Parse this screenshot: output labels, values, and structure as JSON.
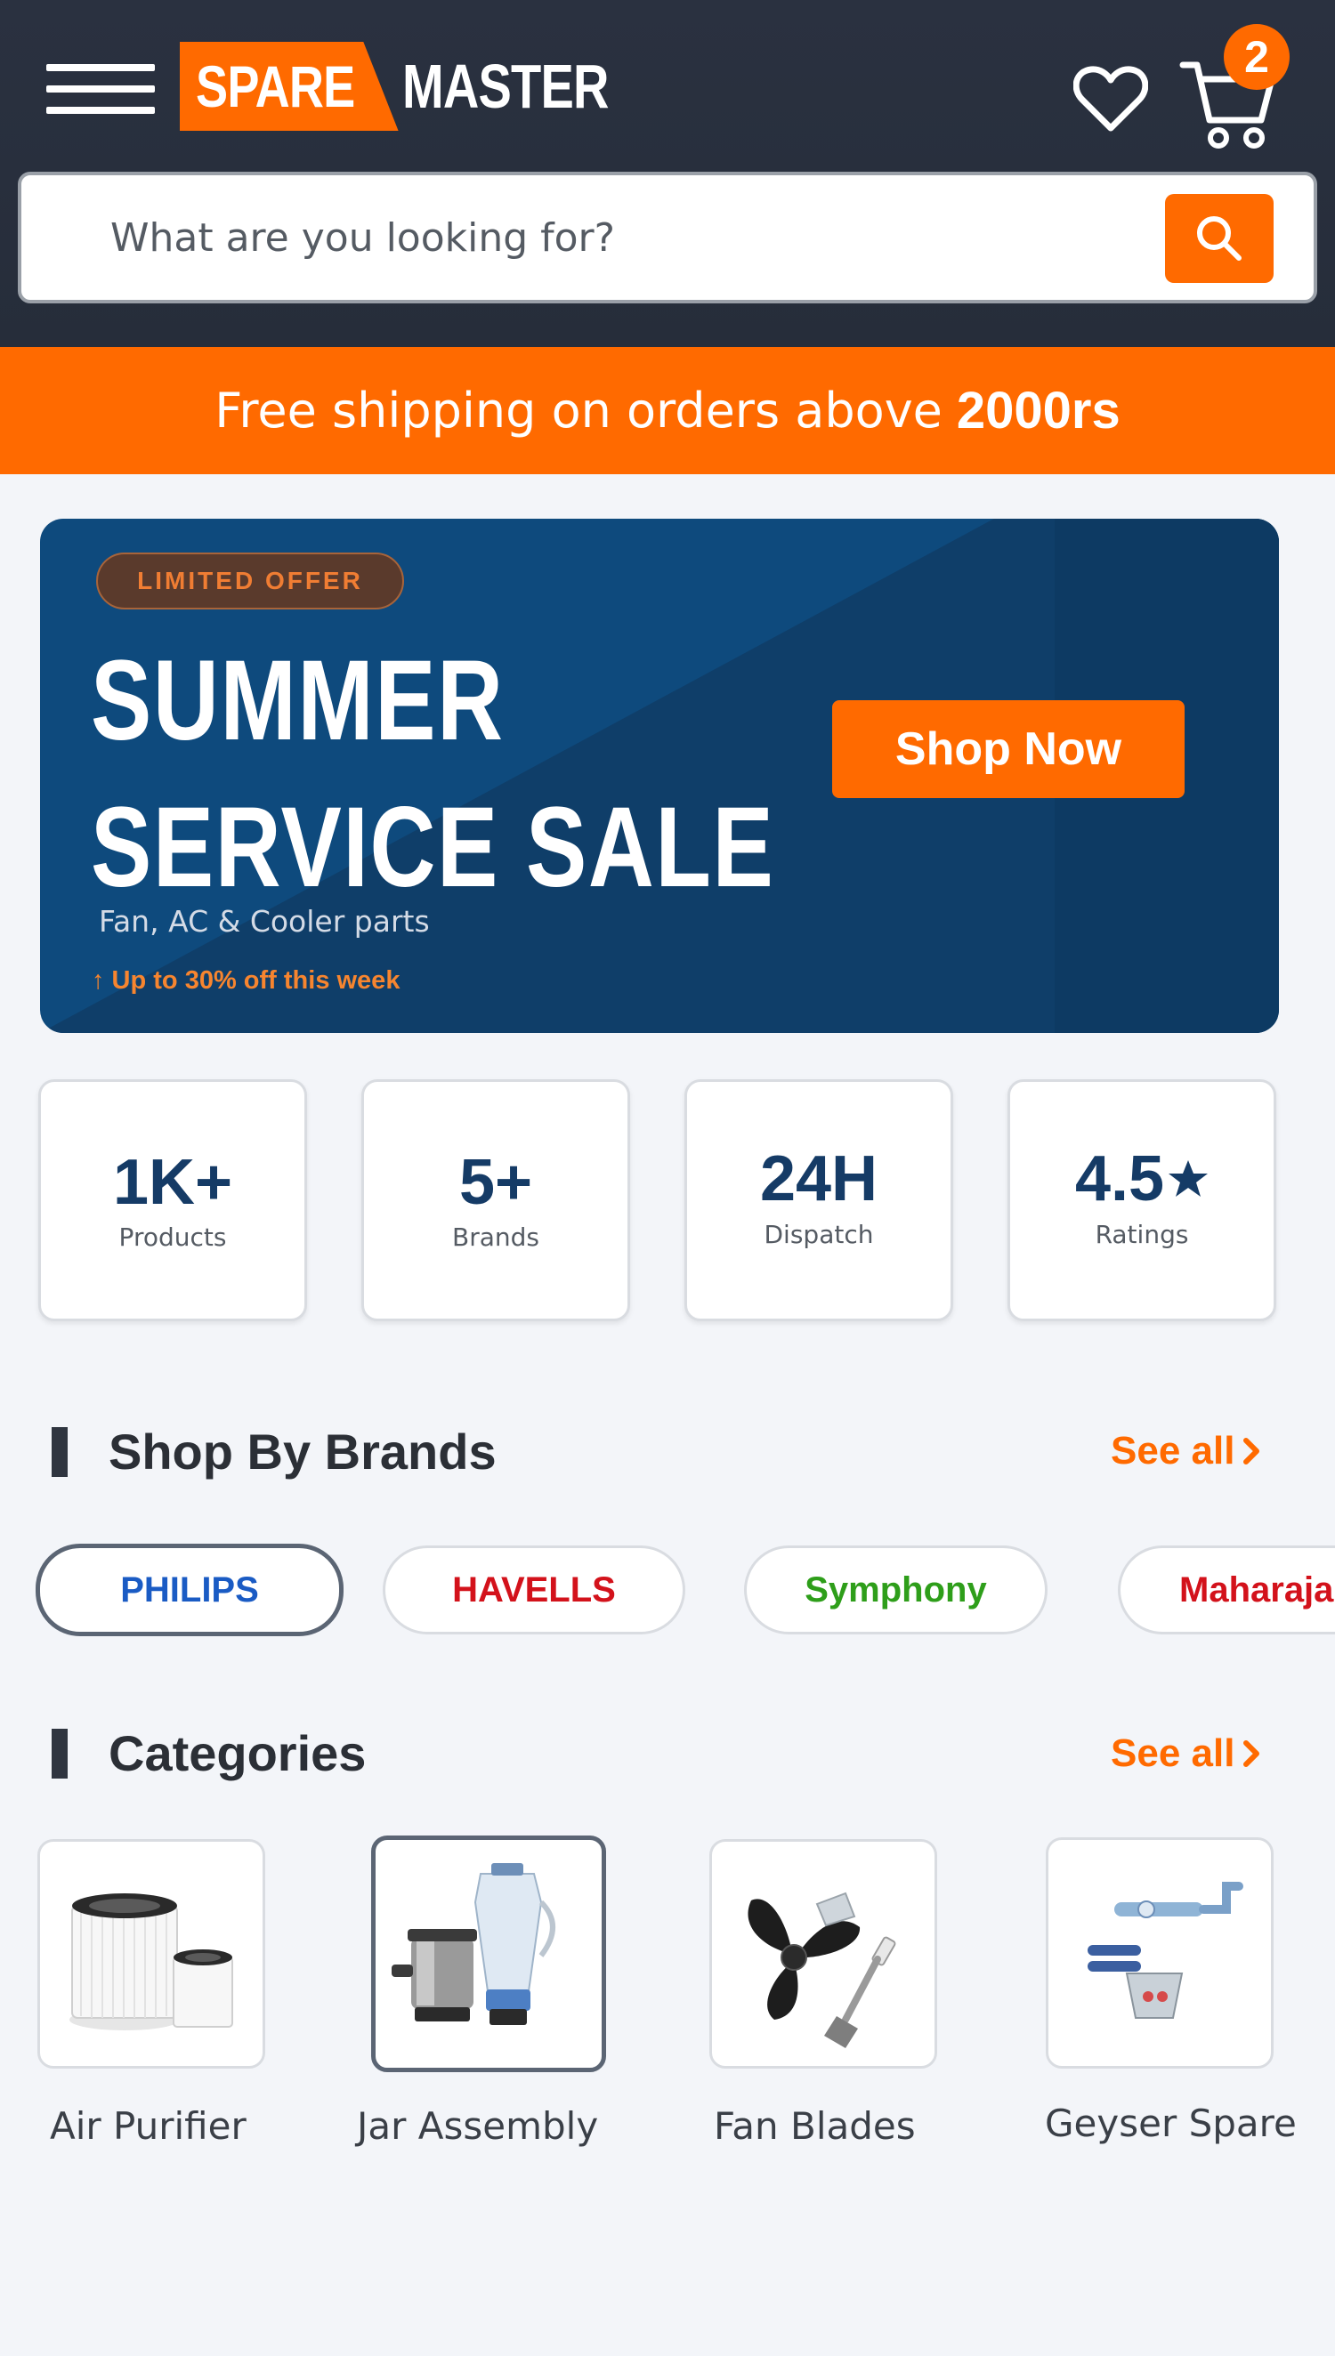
{
  "header": {
    "logo_part1": "SPARE",
    "logo_part2": "MASTER",
    "cart_count": "2",
    "search_placeholder": "What are you looking for?"
  },
  "shipping": {
    "text": "Free shipping on orders above",
    "amount": "2000rs"
  },
  "banner": {
    "chip": "LIMITED OFFER",
    "title_line1": "SUMMER",
    "title_line2": "SERVICE SALE",
    "subtitle": "Fan, AC & Cooler parts",
    "note": "↑ Up to 30% off this week",
    "cta": "Shop Now"
  },
  "stats": [
    {
      "value": "1K+",
      "label": "Products"
    },
    {
      "value": "5+",
      "label": "Brands"
    },
    {
      "value": "24H",
      "label": "Dispatch"
    },
    {
      "value": "4.5",
      "label": "Ratings"
    }
  ],
  "brands_section": {
    "title": "Shop By Brands",
    "see_all": "See all",
    "items": [
      {
        "label": "PHILIPS",
        "color": "#1a5bc4"
      },
      {
        "label": "HAVELLS",
        "color": "#d3121b"
      },
      {
        "label": "Symphony",
        "color": "#2e9e1a"
      },
      {
        "label": "Maharaja",
        "color": "#d3121b"
      }
    ]
  },
  "categories_section": {
    "title": "Categories",
    "see_all": "See all",
    "items": [
      {
        "label": "Air Purifier"
      },
      {
        "label": "Jar Assembly"
      },
      {
        "label": "Fan Blades"
      },
      {
        "label": "Geyser Spare"
      }
    ]
  },
  "colors": {
    "accent": "#ff6a00",
    "header_bg": "#262d3a",
    "banner_bg": "#0e4a7d",
    "stat_text": "#153b66"
  }
}
